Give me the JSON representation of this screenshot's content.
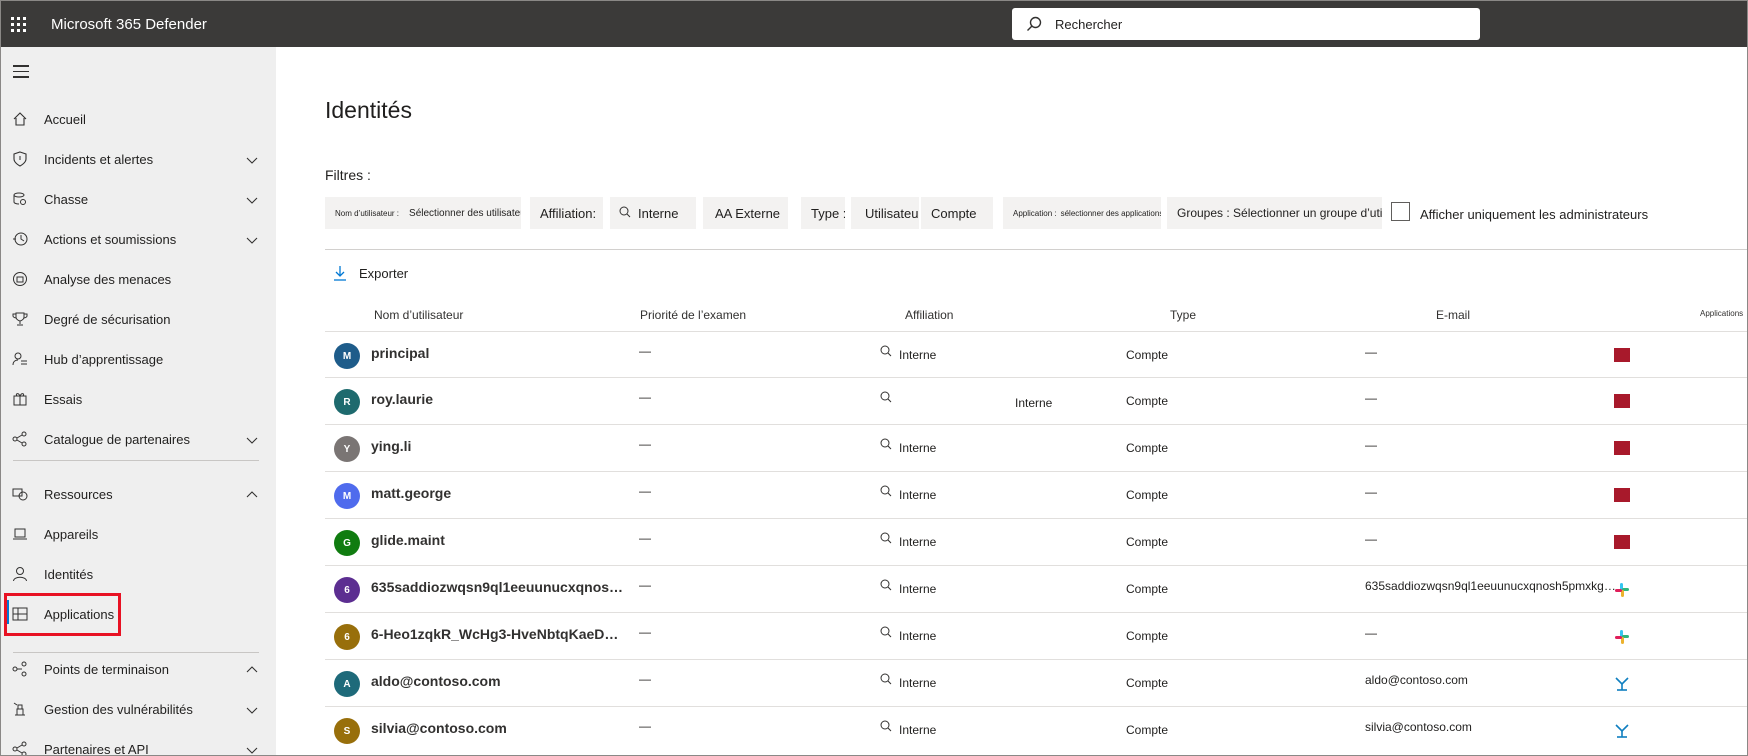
{
  "app": {
    "title": "Microsoft 365 Defender"
  },
  "search": {
    "placeholder": "Rechercher"
  },
  "sidebar": {
    "items": [
      {
        "label": "Accueil",
        "icon": "home-icon",
        "chevron": ""
      },
      {
        "label": "Incidents et alertes",
        "icon": "shield-icon",
        "chevron": "down"
      },
      {
        "label": "Chasse",
        "icon": "hunting-icon",
        "chevron": "down"
      },
      {
        "label": "Actions et soumissions",
        "icon": "history-icon",
        "chevron": "down"
      },
      {
        "label": "Analyse des menaces",
        "icon": "threat-analytics-icon",
        "chevron": ""
      },
      {
        "label": "Degré de sécurisation",
        "icon": "trophy-icon",
        "chevron": ""
      },
      {
        "label": "Hub d’apprentissage",
        "icon": "learning-icon",
        "chevron": ""
      },
      {
        "label": "Essais",
        "icon": "trials-icon",
        "chevron": ""
      },
      {
        "label": "Catalogue de partenaires",
        "icon": "partners-icon",
        "chevron": "down"
      },
      {
        "label": "Ressources",
        "icon": "assets-icon",
        "chevron": "up"
      },
      {
        "label": "Appareils",
        "icon": "laptop-icon",
        "chevron": ""
      },
      {
        "label": "Identités",
        "icon": "person-icon",
        "chevron": ""
      },
      {
        "label": "Applications",
        "icon": "apps-icon",
        "chevron": ""
      },
      {
        "label": "Points de terminaison",
        "icon": "endpoints-icon",
        "chevron": "up"
      },
      {
        "label": "Gestion des vulnérabilités",
        "icon": "vulnerability-icon",
        "chevron": "down"
      },
      {
        "label": "Partenaires et API",
        "icon": "api-icon",
        "chevron": "down"
      }
    ]
  },
  "main": {
    "title": "Identités",
    "filters_label": "Filtres :",
    "filters": {
      "username_label": "Nom d’utilisateur :",
      "username_value": "Sélectionner des utilisateurs",
      "affiliation_label": "Affiliation:",
      "affiliation_internal": "Interne",
      "affiliation_external": "AA Externe",
      "type_label": "Type :",
      "type_user": "Utilisateur",
      "type_account": "Compte",
      "application_label": "Application :",
      "application_value": "sélectionner des applications",
      "groups_value": "Groupes : Sélectionner un groupe d’utilisateurs",
      "admins_only": "Afficher uniquement les administrateurs"
    },
    "export_label": "Exporter",
    "columns": {
      "username": "Nom d’utilisateur",
      "priority": "Priorité de l’examen",
      "affiliation": "Affiliation",
      "type": "Type",
      "email": "E-mail",
      "applications": "Applications"
    },
    "rows": [
      {
        "initial": "M",
        "color": "#1e5c8a",
        "name": "principal",
        "priority": "—",
        "affiliation": "Interne",
        "type": "Compte",
        "email": "—",
        "app": "now"
      },
      {
        "initial": "R",
        "color": "#1e6a6e",
        "name": "roy.laurie",
        "priority": "—",
        "affiliation": "Interne",
        "type": "Compte",
        "email": "—",
        "app": "now"
      },
      {
        "initial": "Y",
        "color": "#7a7574",
        "name": "ying.li",
        "priority": "—",
        "affiliation": "Interne",
        "type": "Compte",
        "email": "—",
        "app": "now"
      },
      {
        "initial": "M",
        "color": "#4f6bed",
        "name": "matt.george",
        "priority": "—",
        "affiliation": "Interne",
        "type": "Compte",
        "email": "—",
        "app": "now"
      },
      {
        "initial": "G",
        "color": "#107c10",
        "name": "glide.maint",
        "priority": "—",
        "affiliation": "Interne",
        "type": "Compte",
        "email": "—",
        "app": "now"
      },
      {
        "initial": "6",
        "color": "#5c2e91",
        "name": "635saddiozwqsn9ql1eeuunucxqnos…",
        "priority": "—",
        "affiliation": "Interne",
        "type": "Compte",
        "email": "635saddiozwqsn9ql1eeuunucxqnosh5pmxkg…",
        "app": "slack"
      },
      {
        "initial": "6",
        "color": "#986f0b",
        "name": "6-Heo1zqkR_WcHg3-HveNbtqKaeD…",
        "priority": "—",
        "affiliation": "Interne",
        "type": "Compte",
        "email": "—",
        "app": "slack"
      },
      {
        "initial": "A",
        "color": "#1e6a7a",
        "name": "aldo@contoso.com",
        "priority": "—",
        "affiliation": "Interne",
        "type": "Compte",
        "email": "aldo@contoso.com",
        "app": "dynamics"
      },
      {
        "initial": "S",
        "color": "#986f0b",
        "name": "silvia@contoso.com",
        "priority": "—",
        "affiliation": "Interne",
        "type": "Compte",
        "email": "silvia@contoso.com",
        "app": "dynamics"
      }
    ]
  }
}
